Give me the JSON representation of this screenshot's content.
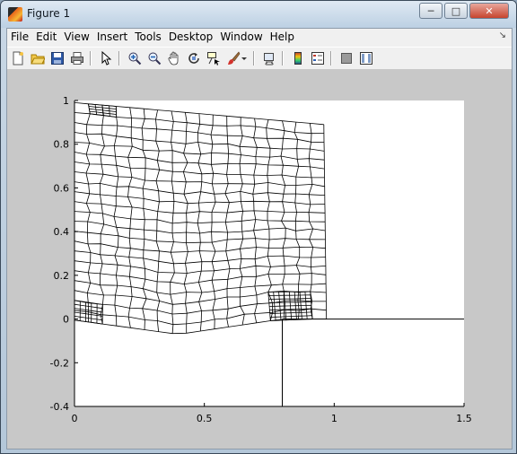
{
  "window": {
    "title": "Figure 1",
    "minimize": "─",
    "maximize": "□",
    "close": "✕"
  },
  "menu": [
    "File",
    "Edit",
    "View",
    "Insert",
    "Tools",
    "Desktop",
    "Window",
    "Help"
  ],
  "menu_dock_glyph": "↘",
  "toolbar": [
    {
      "name": "new-figure-icon"
    },
    {
      "name": "open-file-icon"
    },
    {
      "name": "save-figure-icon"
    },
    {
      "name": "print-figure-icon"
    },
    {
      "name": "edit-plot-arrow-icon"
    },
    {
      "name": "zoom-in-icon"
    },
    {
      "name": "zoom-out-icon"
    },
    {
      "name": "pan-hand-icon"
    },
    {
      "name": "rotate-3d-icon"
    },
    {
      "name": "data-cursor-icon"
    },
    {
      "name": "brush-icon"
    },
    {
      "name": "brush-dropdown-icon"
    },
    {
      "name": "link-plot-icon"
    },
    {
      "name": "insert-colorbar-icon"
    },
    {
      "name": "insert-legend-icon"
    },
    {
      "name": "hide-plot-tools-icon"
    },
    {
      "name": "show-plot-tools-icon"
    }
  ],
  "axes": {
    "xlim": [
      0,
      1.5
    ],
    "ylim": [
      -0.4,
      1
    ],
    "xticks": [
      "0",
      "0.5",
      "1",
      "1.5"
    ],
    "xtick_values": [
      0,
      0.5,
      1,
      1.5
    ],
    "yticks": [
      "1",
      "0.8",
      "0.6",
      "0.4",
      "0.2",
      "0",
      "-0.2",
      "-0.4"
    ],
    "ytick_values": [
      1,
      0.8,
      0.6,
      0.4,
      0.2,
      0,
      -0.2,
      -0.4
    ],
    "background": "#ffffff",
    "figure_background": "#c8c8c8",
    "line_color": "#000000"
  },
  "chart_data": {
    "type": "line",
    "description_series": [
      {
        "x": [
          0.8,
          1.5
        ],
        "y": [
          0,
          0
        ]
      },
      {
        "x": [
          0.8,
          0.8
        ],
        "y": [
          -0.4,
          0
        ]
      }
    ],
    "mesh": {
      "top_edge": [
        [
          0,
          0.99
        ],
        [
          0.96,
          0.89
        ]
      ],
      "right_edge": [
        [
          0.96,
          0.89
        ],
        [
          0.97,
          0.0
        ]
      ],
      "bottom_edge": [
        [
          0,
          -0.005
        ],
        [
          0.4,
          -0.07
        ],
        [
          0.8,
          0.0
        ],
        [
          0.97,
          0.0
        ]
      ],
      "left_edge": [
        [
          0,
          -0.005
        ],
        [
          0,
          0.99
        ]
      ]
    },
    "xlim": [
      0,
      1.5
    ],
    "ylim": [
      -0.4,
      1
    ]
  }
}
